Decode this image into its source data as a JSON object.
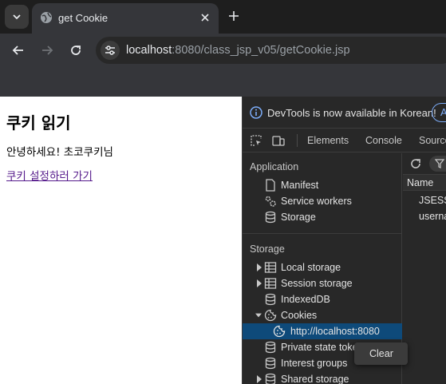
{
  "browser": {
    "tab_title": "get Cookie",
    "url_host": "localhost",
    "url_rest": ":8080/class_jsp_v05/getCookie.jsp"
  },
  "page": {
    "title": "쿠키 읽기",
    "greeting": "안녕하세요! 초코쿠키님",
    "link": "쿠키 설정하러 가기"
  },
  "devtools": {
    "banner": "DevTools is now available in Korean!",
    "banner_button": "A",
    "tabs": [
      "Elements",
      "Console",
      "Source"
    ],
    "sidebar": {
      "application_header": "Application",
      "application_items": [
        "Manifest",
        "Service workers",
        "Storage"
      ],
      "storage_header": "Storage",
      "storage_items": [
        "Local storage",
        "Session storage",
        "IndexedDB",
        "Cookies",
        "http://localhost:8080",
        "Private state toke",
        "Interest groups",
        "Shared storage"
      ]
    },
    "table": {
      "column_name": "Name",
      "rows": [
        "JSESSI",
        "userna"
      ]
    },
    "context_menu": {
      "clear": "Clear"
    }
  }
}
